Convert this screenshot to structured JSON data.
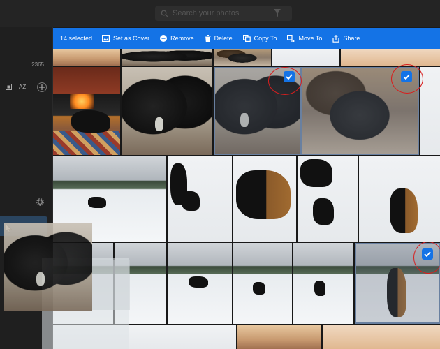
{
  "search": {
    "placeholder": "Search your photos"
  },
  "sidebar": {
    "count": "2365",
    "sort_label": "AZ"
  },
  "actionbar": {
    "selected": "14 selected",
    "actions": [
      {
        "label": "Set as Cover",
        "icon": "image-icon"
      },
      {
        "label": "Remove",
        "icon": "minus-circle-icon"
      },
      {
        "label": "Delete",
        "icon": "trash-icon"
      },
      {
        "label": "Copy To",
        "icon": "copy-icon"
      },
      {
        "label": "Move To",
        "icon": "move-icon"
      },
      {
        "label": "Share",
        "icon": "share-icon"
      }
    ]
  },
  "colors": {
    "accent": "#1473e6",
    "highlight_ring": "#d81e1e"
  }
}
